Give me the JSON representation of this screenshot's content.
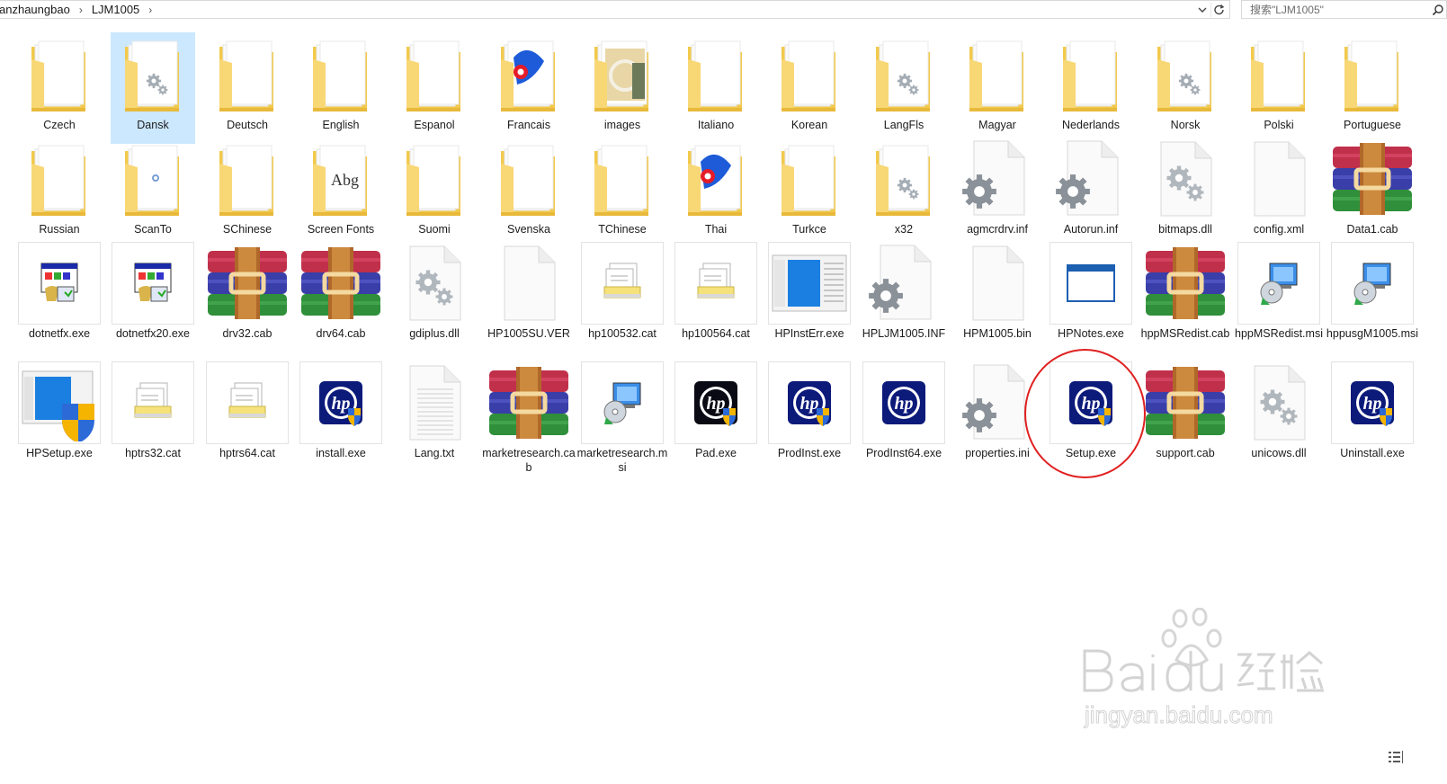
{
  "addressbar": {
    "crumbs": [
      "anzhaungbao",
      "LJM1005"
    ],
    "search_placeholder": "搜索\"LJM1005\""
  },
  "icons": {
    "chevron": "chevron-right-icon",
    "dropdown": "chevron-down-icon",
    "refresh": "refresh-icon",
    "search": "search-icon",
    "view": "details-view-icon"
  },
  "colors": {
    "selection": "#cce8ff",
    "highlight": "#e02020",
    "folder": "#f8d775"
  },
  "items": [
    {
      "label": "Czech",
      "type": "folder"
    },
    {
      "label": "Dansk",
      "type": "folder-gear",
      "selected": true
    },
    {
      "label": "Deutsch",
      "type": "folder"
    },
    {
      "label": "English",
      "type": "folder"
    },
    {
      "label": "Espanol",
      "type": "folder"
    },
    {
      "label": "Francais",
      "type": "folder-hp"
    },
    {
      "label": "images",
      "type": "folder-image"
    },
    {
      "label": "Italiano",
      "type": "folder"
    },
    {
      "label": "Korean",
      "type": "folder"
    },
    {
      "label": "LangFls",
      "type": "folder-gear"
    },
    {
      "label": "Magyar",
      "type": "folder"
    },
    {
      "label": "Nederlands",
      "type": "folder"
    },
    {
      "label": "Norsk",
      "type": "folder-gear"
    },
    {
      "label": "Polski",
      "type": "folder"
    },
    {
      "label": "Portuguese",
      "type": "folder"
    },
    {
      "label": "Russian",
      "type": "folder"
    },
    {
      "label": "ScanTo",
      "type": "folder-small"
    },
    {
      "label": "SChinese",
      "type": "folder"
    },
    {
      "label": "Screen Fonts",
      "type": "folder-font"
    },
    {
      "label": "Suomi",
      "type": "folder"
    },
    {
      "label": "Svenska",
      "type": "folder"
    },
    {
      "label": "TChinese",
      "type": "folder"
    },
    {
      "label": "Thai",
      "type": "folder-hp"
    },
    {
      "label": "Turkce",
      "type": "folder"
    },
    {
      "label": "x32",
      "type": "folder-gear"
    },
    {
      "label": "agmcrdrv.inf",
      "type": "gear-doc"
    },
    {
      "label": "Autorun.inf",
      "type": "gear-doc"
    },
    {
      "label": "bitmaps.dll",
      "type": "dll"
    },
    {
      "label": "config.xml",
      "type": "doc"
    },
    {
      "label": "Data1.cab",
      "type": "winrar"
    },
    {
      "label": "dotnetfx.exe",
      "type": "setup-exe"
    },
    {
      "label": "dotnetfx20.exe",
      "type": "setup-exe"
    },
    {
      "label": "drv32.cab",
      "type": "winrar"
    },
    {
      "label": "drv64.cab",
      "type": "winrar"
    },
    {
      "label": "gdiplus.dll",
      "type": "dll"
    },
    {
      "label": "HP1005SU.VER",
      "type": "doc"
    },
    {
      "label": "hp100532.cat",
      "type": "cat"
    },
    {
      "label": "hp100564.cat",
      "type": "cat"
    },
    {
      "label": "HPInstErr.exe",
      "type": "window-thumb"
    },
    {
      "label": "HPLJM1005.INF",
      "type": "gear-doc"
    },
    {
      "label": "HPM1005.bin",
      "type": "doc"
    },
    {
      "label": "HPNotes.exe",
      "type": "app-window"
    },
    {
      "label": "hppMSRedist.cab",
      "type": "winrar"
    },
    {
      "label": "hppMSRedist.msi",
      "type": "msi"
    },
    {
      "label": "hppusgM1005.msi",
      "type": "msi"
    },
    {
      "label": "HPSetup.exe",
      "type": "shield-setup"
    },
    {
      "label": "hptrs32.cat",
      "type": "cat"
    },
    {
      "label": "hptrs64.cat",
      "type": "cat"
    },
    {
      "label": "install.exe",
      "type": "hp-exe"
    },
    {
      "label": "Lang.txt",
      "type": "txt"
    },
    {
      "label": "marketresearch.cab",
      "type": "winrar"
    },
    {
      "label": "marketresearch.msi",
      "type": "msi"
    },
    {
      "label": "Pad.exe",
      "type": "hp-exe-dark"
    },
    {
      "label": "ProdInst.exe",
      "type": "hp-exe"
    },
    {
      "label": "ProdInst64.exe",
      "type": "hp-exe-plain"
    },
    {
      "label": "properties.ini",
      "type": "gear-doc"
    },
    {
      "label": "Setup.exe",
      "type": "hp-exe"
    },
    {
      "label": "support.cab",
      "type": "winrar"
    },
    {
      "label": "unicows.dll",
      "type": "dll"
    },
    {
      "label": "Uninstall.exe",
      "type": "hp-exe"
    }
  ]
}
